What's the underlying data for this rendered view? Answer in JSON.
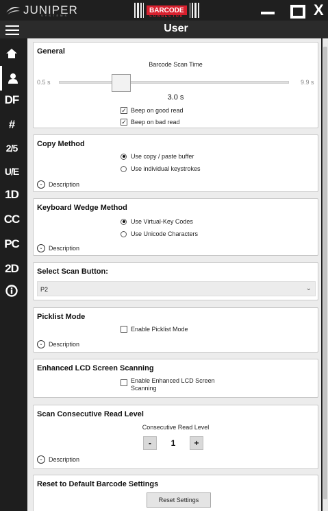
{
  "titlebar": {
    "brand": "JUNIPER",
    "brand_sub": "SYSTEMS",
    "logo_text": "BARCODE",
    "logo_sub": "CONNECTOR",
    "close_glyph": "X"
  },
  "header": {
    "title": "User"
  },
  "sidebar": {
    "items": [
      {
        "label": "",
        "icon": "home-icon"
      },
      {
        "label": "",
        "icon": "user-icon"
      },
      {
        "label": "DF"
      },
      {
        "label": "#"
      },
      {
        "label": "2/5"
      },
      {
        "label": "U/E"
      },
      {
        "label": "1D"
      },
      {
        "label": "CC"
      },
      {
        "label": "PC"
      },
      {
        "label": "2D"
      },
      {
        "label": "",
        "icon": "info-icon"
      }
    ]
  },
  "general": {
    "title": "General",
    "slider_label": "Barcode Scan Time",
    "min": "0.5 s",
    "max": "9.9 s",
    "value_label": "3.0 s",
    "value": 3.0,
    "beep_good": "Beep on good read",
    "beep_bad": "Beep on bad read"
  },
  "copy_method": {
    "title": "Copy Method",
    "opt1": "Use copy / paste buffer",
    "opt2": "Use individual keystrokes",
    "description": "Description"
  },
  "wedge": {
    "title": "Keyboard Wedge Method",
    "opt1": "Use Virtual-Key Codes",
    "opt2": "Use Unicode Characters",
    "description": "Description"
  },
  "scan_button": {
    "title": "Select Scan Button:",
    "selected": "P2"
  },
  "picklist": {
    "title": "Picklist Mode",
    "option": "Enable Picklist Mode",
    "description": "Description"
  },
  "lcd": {
    "title": "Enhanced LCD Screen Scanning",
    "option_line1": "Enable Enhanced LCD Screen",
    "option_line2": "Scanning"
  },
  "consecutive": {
    "title": "Scan Consecutive Read Level",
    "label": "Consecutive Read Level",
    "minus": "-",
    "value": "1",
    "plus": "+",
    "description": "Description"
  },
  "reset": {
    "title": "Reset to Default Barcode Settings",
    "button": "Reset Settings"
  },
  "colors": {
    "logo_red": "#d8202e",
    "sidebar_bg": "#1e1e1e",
    "content_bg": "#ececec"
  }
}
